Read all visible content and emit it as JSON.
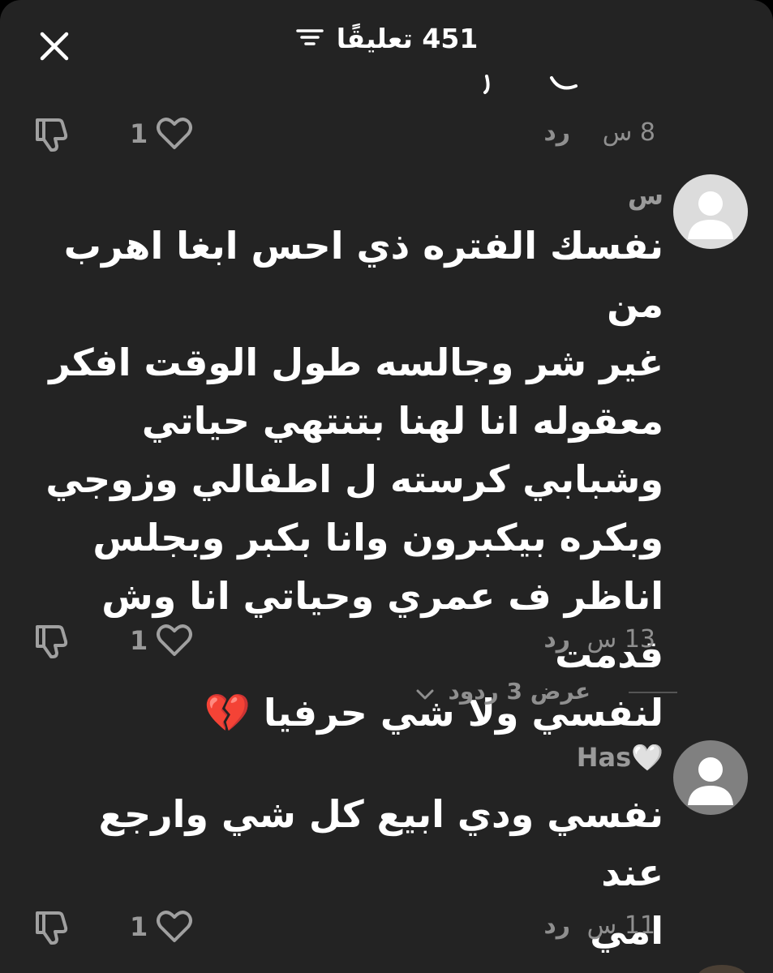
{
  "header": {
    "title": "451 تعليقًا",
    "close_icon": "close-icon",
    "sort_icon": "sort-filter-icon"
  },
  "comments": [
    {
      "partial": true,
      "timestamp": "8 س",
      "reply_label": "رد",
      "likes": "1"
    },
    {
      "username": "س",
      "text": "نفسك الفتره ذي احس ابغا اهرب من\nغير شر وجالسه طول الوقت افكر\nمعقوله انا لهنا بتنتهي حياتي\nوشبابي كرسته ل اطفالي وزوجي\nوبكره بيكبرون وانا بكبر وبجلس\nاناظر ف عمري وحياتي انا وش قدمت\nلنفسي ولا شي حرفيا 💔",
      "timestamp": "13 س",
      "reply_label": "رد",
      "likes": "1",
      "view_replies": "عرض 3 ردود"
    },
    {
      "username": "Has🤍",
      "text": "نفسي ودي ابيع كل شي وارجع عند\nامي",
      "timestamp": "11 س",
      "reply_label": "رد",
      "likes": "1"
    }
  ],
  "colors": {
    "sheet_bg": "#232323",
    "muted_text": "#8f8f8f",
    "body_text": "#ffffff",
    "icon_gray": "#9a9a9a"
  }
}
